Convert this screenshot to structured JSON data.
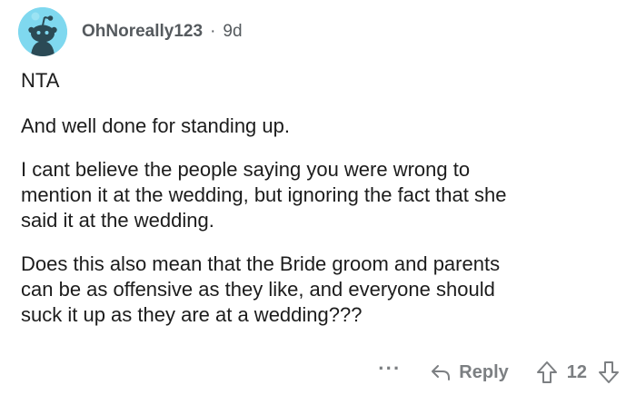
{
  "comment": {
    "author": "OhNoreally123",
    "separator": "·",
    "age": "9d",
    "avatar_icon": "reddit-snoo-avatar",
    "avatar_color": "#7fd8ef",
    "paragraphs": [
      "NTA",
      "And well done for standing up.",
      "I cant believe the people saying you were wrong to\nmention it at the wedding, but ignoring the fact that she\nsaid it at the wedding.",
      "Does this also mean that the Bride groom and parents\ncan be as offensive as they like, and everyone should\nsuck it up as they are at a wedding???"
    ]
  },
  "actions": {
    "more_label": "···",
    "more_icon": "more-options-icon",
    "reply_icon": "reply-arrow-icon",
    "reply_label": "Reply",
    "upvote_icon": "upvote-arrow-icon",
    "score": "12",
    "downvote_icon": "downvote-arrow-icon",
    "muted_color": "#7c7f82"
  }
}
